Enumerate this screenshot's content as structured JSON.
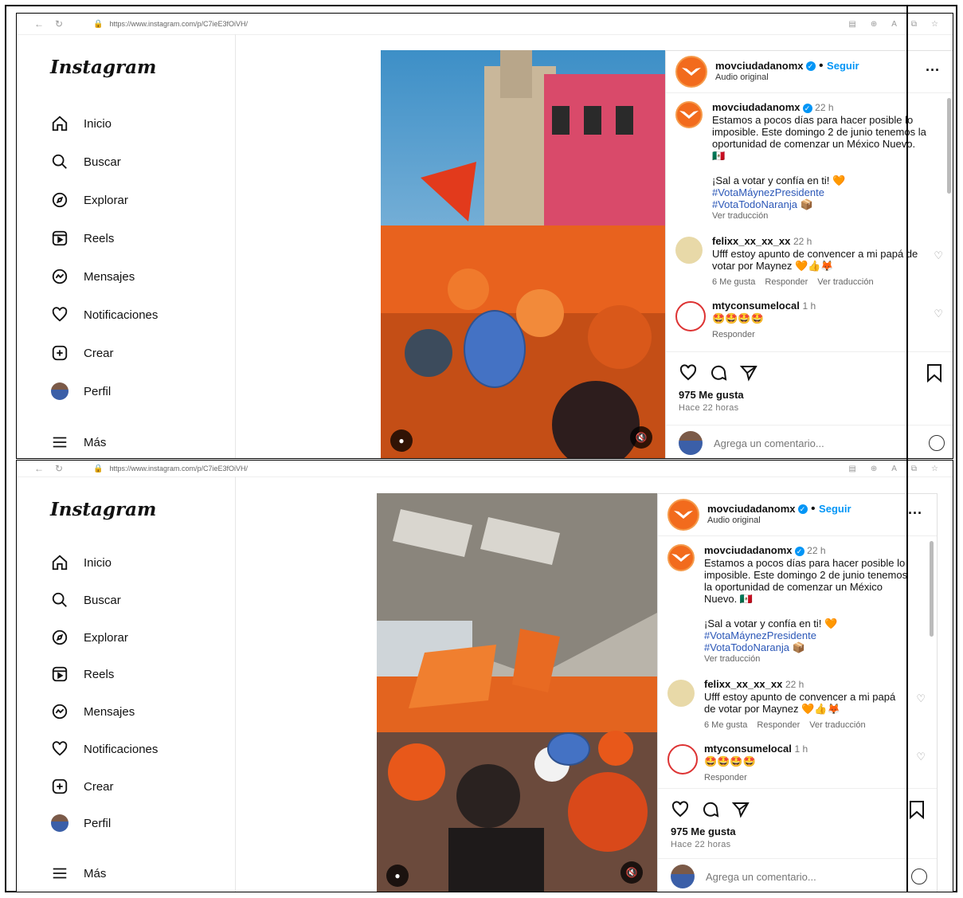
{
  "browser": {
    "url": "https://www.instagram.com/p/C7ieE3fOiVH/"
  },
  "sidebar": {
    "logo": "Instagram",
    "items": [
      {
        "label": "Inicio",
        "icon": "home-icon"
      },
      {
        "label": "Buscar",
        "icon": "search-icon"
      },
      {
        "label": "Explorar",
        "icon": "compass-icon"
      },
      {
        "label": "Reels",
        "icon": "reels-icon"
      },
      {
        "label": "Mensajes",
        "icon": "messenger-icon"
      },
      {
        "label": "Notificaciones",
        "icon": "heart-icon"
      },
      {
        "label": "Crear",
        "icon": "plus-square-icon"
      },
      {
        "label": "Perfil",
        "icon": "avatar"
      }
    ],
    "more": "Más"
  },
  "post": {
    "username": "movciudadanomx",
    "dot": "•",
    "follow": "Seguir",
    "audio": "Audio original",
    "caption": {
      "time": "22 h",
      "text": "Estamos a pocos días para hacer posible lo imposible. Este domingo 2 de junio tenemos la oportunidad de comenzar un México Nuevo. 🇲🇽",
      "line2": "¡Sal a votar y confía en ti! 🧡",
      "hashtag1": "#VotaMáynezPresidente",
      "hashtag2": "#VotaTodoNaranja 📦",
      "translate": "Ver traducción"
    },
    "comment1": {
      "user": "felixx_xx_xx_xx",
      "time": "22 h",
      "text": "Ufff estoy apunto de convencer a mi papá de votar por Maynez 🧡👍🦊",
      "likes": "6 Me gusta",
      "reply": "Responder",
      "translate": "Ver traducción"
    },
    "comment2": {
      "user": "mtyconsumelocal",
      "time": "1 h",
      "text": "🤩🤩🤩🤩",
      "reply": "Responder"
    },
    "likes": "975 Me gusta",
    "ago": "Hace 22 horas",
    "add_comment": "Agrega un comentario..."
  },
  "colors": {
    "accent": "#0095f6",
    "brand_orange": "#f26b1d",
    "blur_mask": "#4472c4"
  }
}
